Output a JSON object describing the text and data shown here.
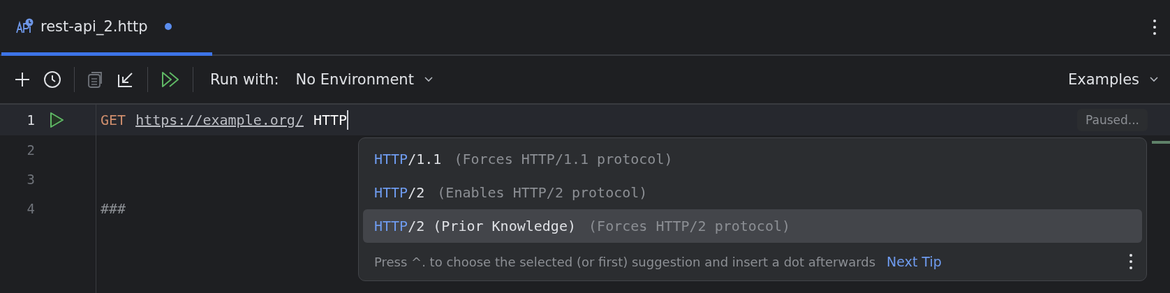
{
  "tabs": [
    {
      "label": "rest-api_2.http",
      "selected": true,
      "modified": true
    }
  ],
  "toolbar": {
    "run_with_label": "Run with:",
    "environment": "No Environment",
    "examples": "Examples"
  },
  "editor": {
    "lines": [
      {
        "number": "1",
        "runnable": true,
        "current": true,
        "tokens": [
          {
            "kind": "method",
            "text": "GET"
          },
          {
            "kind": "url",
            "text": "https://example.org/"
          },
          {
            "kind": "typed",
            "text": "HTTP"
          }
        ]
      },
      {
        "number": "2",
        "runnable": false,
        "current": false
      },
      {
        "number": "3",
        "runnable": false,
        "current": false
      },
      {
        "number": "4",
        "runnable": false,
        "current": false,
        "tokens": [
          {
            "kind": "separator",
            "text": "###"
          }
        ]
      }
    ],
    "status_badge": "Paused..."
  },
  "completion": {
    "items": [
      {
        "match": "HTTP",
        "rest": "/1.1",
        "hint": "(Forces HTTP/1.1 protocol)",
        "selected": false
      },
      {
        "match": "HTTP",
        "rest": "/2",
        "hint": "(Enables HTTP/2 protocol)",
        "selected": false
      },
      {
        "match": "HTTP",
        "rest": "/2 (Prior Knowledge)",
        "hint": "(Forces HTTP/2 protocol)",
        "selected": true
      }
    ],
    "tip": "Press ^. to choose the selected (or first) suggestion and insert a dot afterwards",
    "next_tip": "Next Tip"
  }
}
